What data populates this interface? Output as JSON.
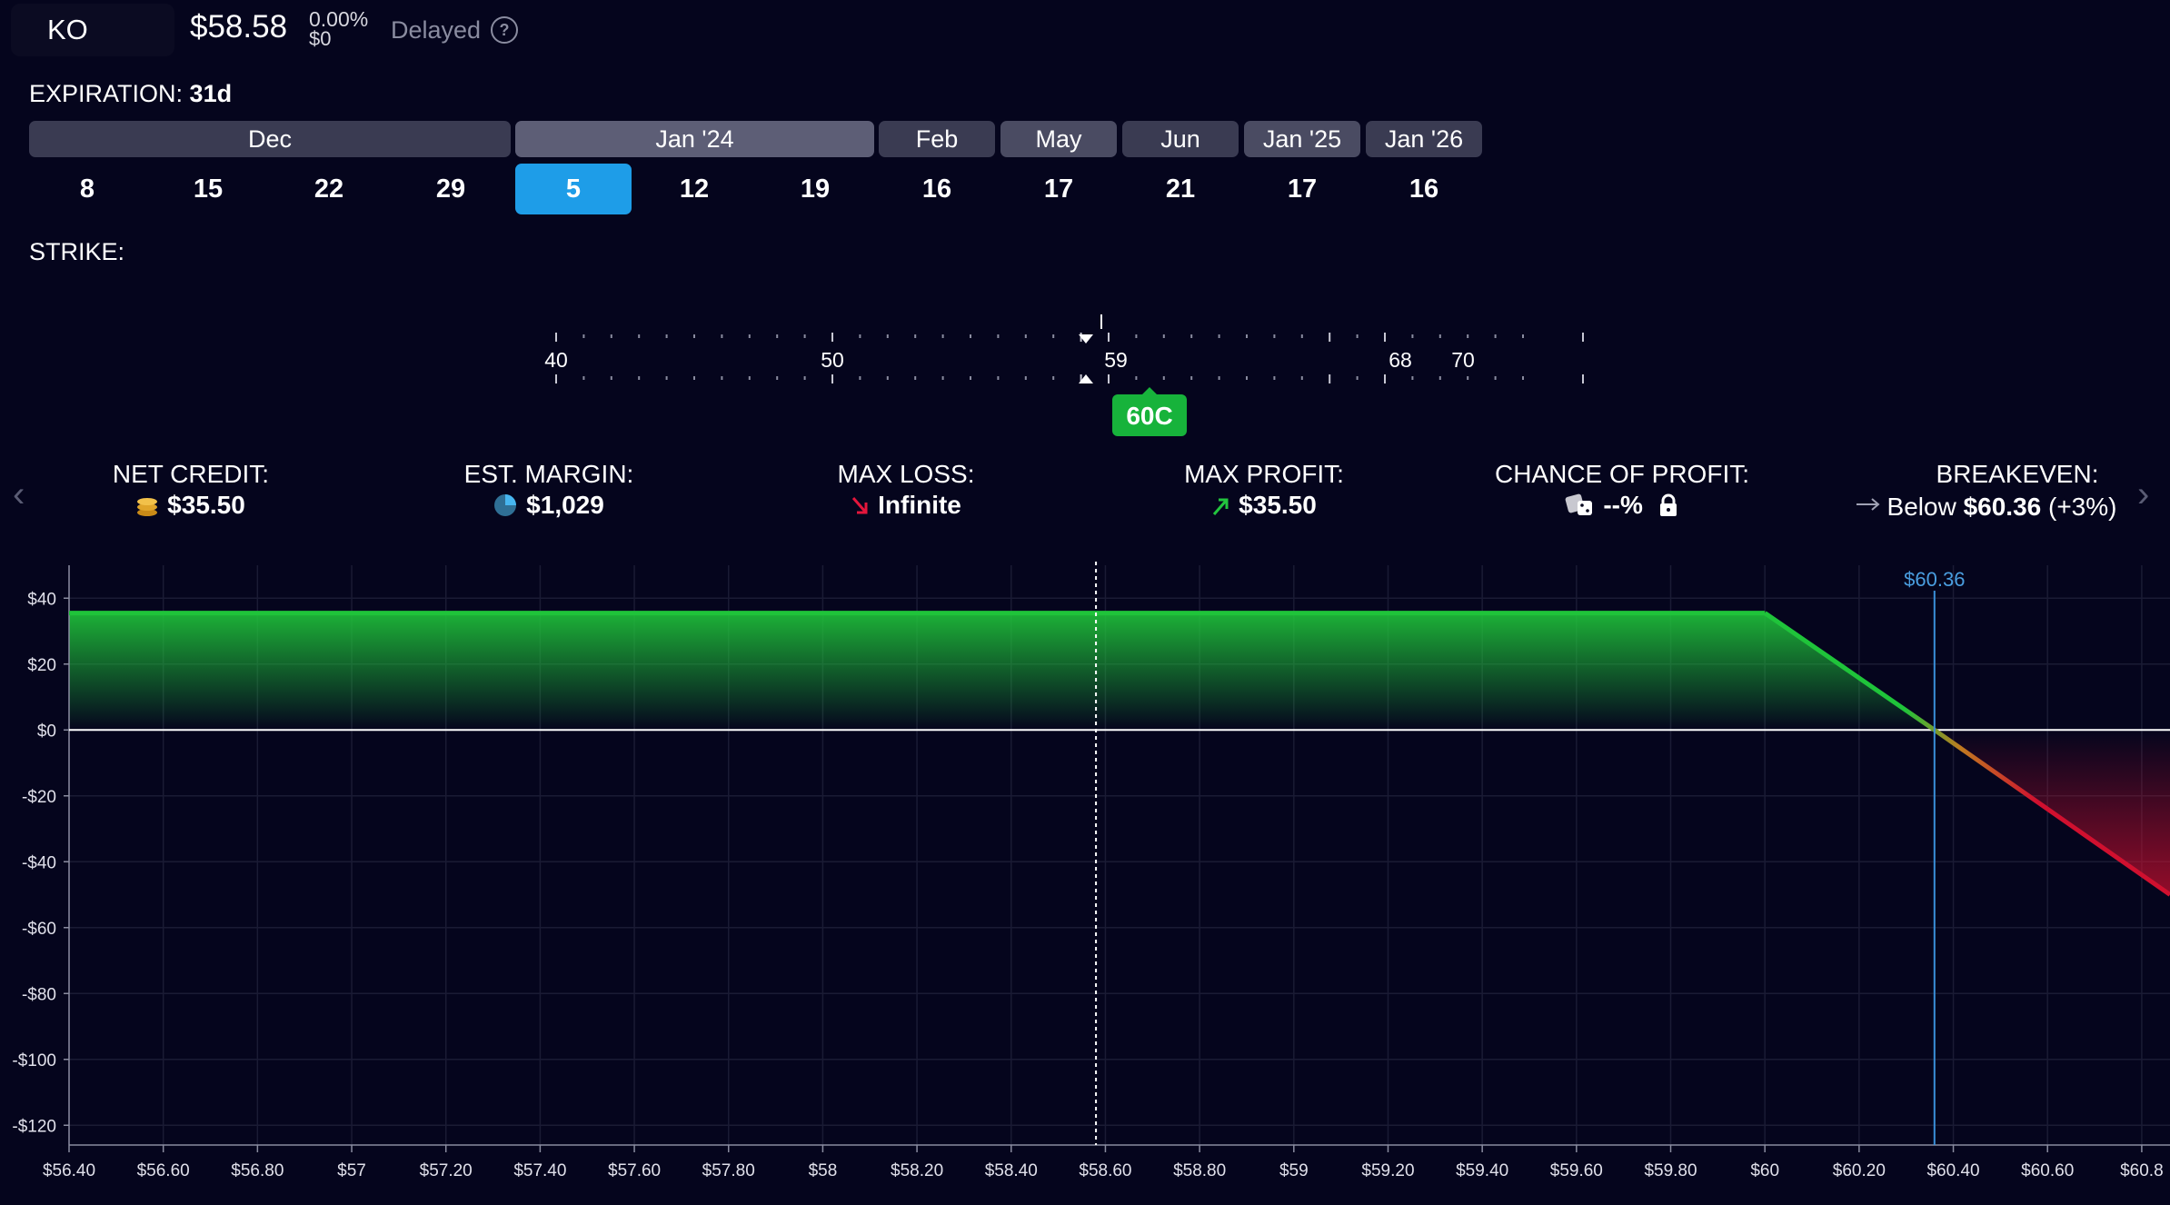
{
  "header": {
    "ticker": "KO",
    "price": "$58.58",
    "change_pct": "0.00%",
    "change_abs": "$0",
    "delayed": "Delayed",
    "help_icon": "?"
  },
  "expiration": {
    "label": "EXPIRATION:",
    "days": "31d",
    "months": [
      "Dec",
      "Jan '24",
      "Feb",
      "May",
      "Jun",
      "Jan '25",
      "Jan '26"
    ],
    "selected_month": "Jan '24",
    "dates": [
      "8",
      "15",
      "22",
      "29",
      "5",
      "12",
      "19",
      "16",
      "17",
      "21",
      "17",
      "16"
    ],
    "selected_date": "5"
  },
  "strike": {
    "label": "STRIKE:",
    "tick_labels": [
      "40",
      "50",
      "59",
      "68",
      "70"
    ],
    "selected_badge": "60C"
  },
  "stats": {
    "net_credit": {
      "label": "NET CREDIT:",
      "value": "$35.50",
      "icon": "coins-icon"
    },
    "est_margin": {
      "label": "EST. MARGIN:",
      "value": "$1,029",
      "icon": "pie-icon"
    },
    "max_loss": {
      "label": "MAX LOSS:",
      "value": "Infinite",
      "icon": "arrow-down-right-icon"
    },
    "max_profit": {
      "label": "MAX PROFIT:",
      "value": "$35.50",
      "icon": "arrow-up-right-icon"
    },
    "chance_of_profit": {
      "label": "CHANCE OF PROFIT:",
      "value": "--%",
      "icon": "dice-icon"
    },
    "breakeven": {
      "label": "BREAKEVEN:",
      "prefix": "Below",
      "value": "$60.36",
      "suffix": "(+3%)",
      "icon": "arrow-right-icon"
    }
  },
  "colors": {
    "background": "#05051d",
    "profit": "#1fc43a",
    "loss": "#d0102f",
    "accent": "#1e9de8",
    "breakeven_line": "#3a8fd8"
  },
  "chart_data": {
    "type": "line",
    "x": [
      56.4,
      60.0,
      60.36,
      60.86
    ],
    "y": [
      35.5,
      35.5,
      0,
      -50
    ],
    "xlim": [
      56.4,
      60.86
    ],
    "ylim": [
      -126,
      50
    ],
    "y_ticks": [
      "$40",
      "$20",
      "$0",
      "-$20",
      "-$40",
      "-$60",
      "-$80",
      "-$100",
      "-$120"
    ],
    "y_tick_values": [
      40,
      20,
      0,
      -20,
      -40,
      -60,
      -80,
      -100,
      -120
    ],
    "x_ticks": [
      "$56.40",
      "$56.60",
      "$56.80",
      "$57",
      "$57.20",
      "$57.40",
      "$57.60",
      "$57.80",
      "$58",
      "$58.20",
      "$58.40",
      "$58.60",
      "$58.80",
      "$59",
      "$59.20",
      "$59.40",
      "$59.60",
      "$59.80",
      "$60",
      "$60.20",
      "$60.40",
      "$60.60",
      "$60.8"
    ],
    "current_price": 58.58,
    "breakeven": 60.36,
    "breakeven_label": "$60.36",
    "grid": true
  }
}
